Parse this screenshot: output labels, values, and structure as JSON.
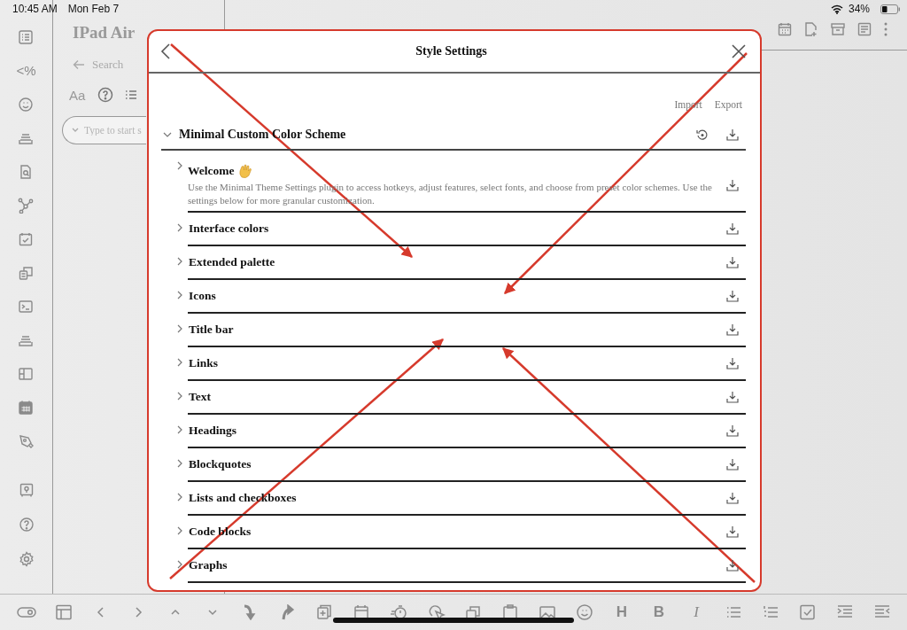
{
  "status_bar": {
    "time": "10:45 AM",
    "date": "Mon Feb 7",
    "battery": "34%"
  },
  "ribbon": {
    "glyph": "<%"
  },
  "sidebar": {
    "title": "IPad Air",
    "back_label": "Search",
    "font_key": "Aa",
    "search": {
      "placeholder": "Type to start s"
    }
  },
  "modal": {
    "title": "Style Settings",
    "actions": [
      "Import",
      "Export"
    ],
    "section": {
      "title": "Minimal Custom Color Scheme",
      "expanded": true,
      "items": [
        {
          "title": "Welcome",
          "expanded": false,
          "description": "Use the Minimal Theme Settings plugin to access hotkeys, adjust features, select fonts, and choose from preset color schemes. Use the settings below for more granular customization."
        },
        {
          "title": "Interface colors",
          "expanded": false
        },
        {
          "title": "Extended palette",
          "expanded": false
        },
        {
          "title": "Icons",
          "expanded": false
        },
        {
          "title": "Title bar",
          "expanded": false
        },
        {
          "title": "Links",
          "expanded": false
        },
        {
          "title": "Text",
          "expanded": false
        },
        {
          "title": "Headings",
          "expanded": false
        },
        {
          "title": "Blockquotes",
          "expanded": false
        },
        {
          "title": "Lists and checkboxes",
          "expanded": false
        },
        {
          "title": "Code blocks",
          "expanded": false
        },
        {
          "title": "Graphs",
          "expanded": false
        }
      ]
    }
  },
  "toolbar": {
    "format_keys": [
      "H",
      "B",
      "I"
    ]
  }
}
